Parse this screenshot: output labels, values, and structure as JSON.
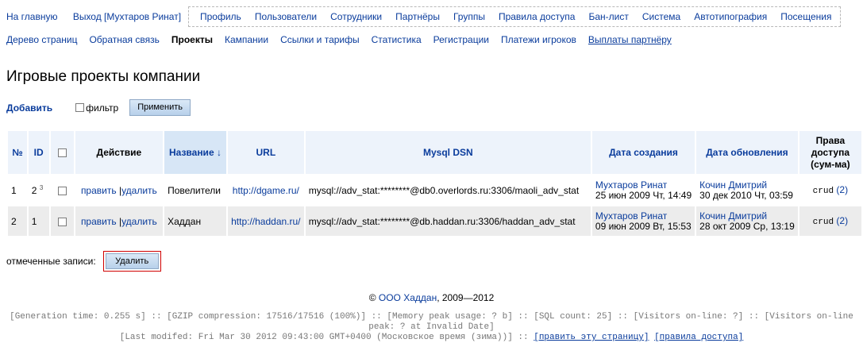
{
  "top": {
    "home": "На главную",
    "logout": "Выход [Мухтаров Ринат]",
    "menu": [
      "Профиль",
      "Пользователи",
      "Сотрудники",
      "Партнёры",
      "Группы",
      "Правила доступа",
      "Бан-лист",
      "Система",
      "Автотипография",
      "Посещения"
    ]
  },
  "subnav": [
    "Дерево страниц",
    "Обратная связь",
    "Проекты",
    "Кампании",
    "Ссылки и тарифы",
    "Статистика",
    "Регистрации",
    "Платежи игроков",
    "Выплаты партнёру"
  ],
  "subnav_active_index": 2,
  "page_title": "Игровые проекты компании",
  "actions": {
    "add": "Добавить",
    "filter": "фильтр",
    "apply": "Применить"
  },
  "table": {
    "headers": {
      "num": "№",
      "id": "ID",
      "action": "Действие",
      "name": "Название ↓",
      "url": "URL",
      "dsn": "Mysql DSN",
      "created": "Дата создания",
      "updated": "Дата обновления",
      "rights": "Права доступа (сум-ма)"
    },
    "rows": [
      {
        "num": "1",
        "id": "2",
        "id_sup": "3",
        "edit": "править",
        "sep": "|",
        "del": "удалить",
        "name": "Повелители",
        "url": "http://dgame.ru/",
        "dsn": "mysql://adv_stat:********@db0.overlords.ru:3306/maoli_adv_stat",
        "created_by": "Мухтаров Ринат",
        "created_at": "25 июн 2009 Чт, 14:49",
        "updated_by": "Кочин Дмитрий",
        "updated_at": "30 дек 2010 Чт, 03:59",
        "rights": "crud",
        "rights_count": "(2)"
      },
      {
        "num": "2",
        "id": "1",
        "id_sup": "",
        "edit": "править",
        "sep": "|",
        "del": "удалить",
        "name": "Хаддан",
        "url": "http://haddan.ru/",
        "dsn": "mysql://adv_stat:********@db.haddan.ru:3306/haddan_adv_stat",
        "created_by": "Мухтаров Ринат",
        "created_at": "09 июн 2009 Вт, 15:53",
        "updated_by": "Кочин Дмитрий",
        "updated_at": "28 окт 2009 Ср, 13:19",
        "rights": "crud",
        "rights_count": "(2)"
      }
    ]
  },
  "marked": {
    "label": "отмеченные записи:",
    "delete": "Удалить"
  },
  "footer": {
    "copy": "©",
    "company": "ООО Хаддан",
    "years": ", 2009—2012"
  },
  "debug": {
    "line1": "[Generation time: 0.255 s] :: [GZIP compression: 17516/17516 (100%)] :: [Memory peak usage: ? b] :: [SQL count: 25] :: [Visitors on-line: ?] :: [Visitors on-line peak: ? at Invalid Date]",
    "line2_text": "[Last modifed: Fri Mar 30 2012 09:43:00 GMT+0400 (Московское время (зима))] ::",
    "edit_page": "[править эту страницу]",
    "access_rules": "[правила доступа]"
  },
  "colors": {
    "link": "#0a3c9c",
    "header_bg": "#edf3fb",
    "sorted_header_bg": "#d7e6f6",
    "row_alt": "#ececec",
    "delete_border": "#d00000"
  }
}
